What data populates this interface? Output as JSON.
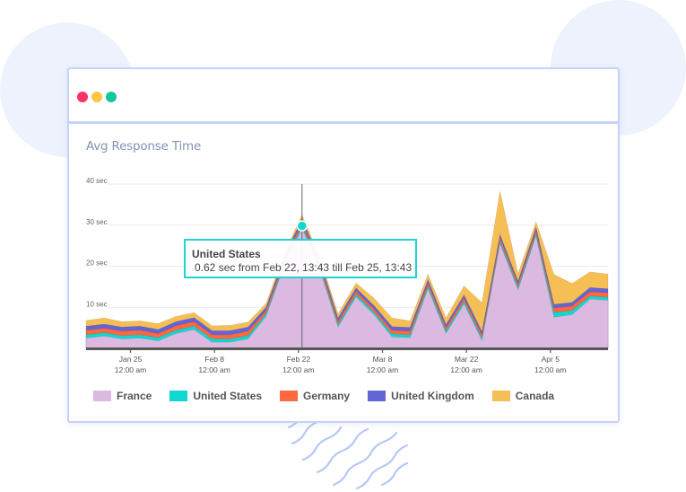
{
  "window": {
    "controls": [
      {
        "name": "close",
        "color": "#fb3263"
      },
      {
        "name": "minimize",
        "color": "#fcc644"
      },
      {
        "name": "maximize",
        "color": "#12c79a"
      }
    ]
  },
  "panel": {
    "title": "Avg Response Time"
  },
  "tooltip": {
    "series": "United States",
    "text": "0.62 sec from Feb 22, 13:43 till Feb 25, 13:43",
    "hover_index": 12
  },
  "chart_data": {
    "type": "area",
    "stacked": true,
    "title": "Avg Response Time",
    "xlabel": "",
    "ylabel": "",
    "ylim": [
      0,
      40
    ],
    "y_ticks": [
      {
        "value": 10,
        "label": "10 sec"
      },
      {
        "value": 20,
        "label": "20 sec"
      },
      {
        "value": 30,
        "label": "30 sec"
      },
      {
        "value": 40,
        "label": "40 sec"
      }
    ],
    "x_domain_days": [
      0,
      87
    ],
    "x_step_days": 3,
    "x_ticks": [
      {
        "day": 7.4,
        "line1": "Jan 25",
        "line2": "12:00 am"
      },
      {
        "day": 21.4,
        "line1": "Feb 8",
        "line2": "12:00 am"
      },
      {
        "day": 35.4,
        "line1": "Feb 22",
        "line2": "12:00 am"
      },
      {
        "day": 49.4,
        "line1": "Mar 8",
        "line2": "12:00 am"
      },
      {
        "day": 63.4,
        "line1": "Mar 22",
        "line2": "12:00 am"
      },
      {
        "day": 77.4,
        "line1": "Apr 5",
        "line2": "12:00 am"
      }
    ],
    "grid": true,
    "legend_position": "bottom-left",
    "series": [
      {
        "name": "France",
        "color": "#dbb9e1",
        "values": [
          2.5,
          3.0,
          2.3,
          2.5,
          1.8,
          3.6,
          4.6,
          1.5,
          1.5,
          2.3,
          7.8,
          20.0,
          29.2,
          19.0,
          5.2,
          12.5,
          8.2,
          2.8,
          2.6,
          14.5,
          3.6,
          10.8,
          1.9,
          25.5,
          14.2,
          27.3,
          7.6,
          8.2,
          12.0,
          11.7
        ]
      },
      {
        "name": "United States",
        "color": "#0fd8d3",
        "values": [
          0.8,
          0.8,
          0.8,
          0.8,
          0.8,
          0.8,
          0.8,
          0.8,
          0.8,
          0.8,
          0.6,
          0.6,
          0.62,
          0.6,
          0.6,
          0.6,
          0.6,
          0.7,
          0.7,
          0.6,
          0.6,
          0.6,
          0.6,
          0.6,
          0.6,
          0.6,
          1.1,
          1.0,
          0.7,
          0.7
        ]
      },
      {
        "name": "Germany",
        "color": "#fd6840",
        "values": [
          1.1,
          1.1,
          1.1,
          1.1,
          1.0,
          1.1,
          1.1,
          1.0,
          1.0,
          1.1,
          0.8,
          0.8,
          0.9,
          0.8,
          0.8,
          0.8,
          0.8,
          0.9,
          0.9,
          0.8,
          0.8,
          0.8,
          0.8,
          0.8,
          0.8,
          0.8,
          1.1,
          1.1,
          1.1,
          1.1
        ]
      },
      {
        "name": "United Kingdom",
        "color": "#6365d6",
        "values": [
          1.0,
          1.0,
          1.0,
          1.0,
          1.0,
          1.0,
          1.0,
          1.0,
          1.0,
          1.0,
          0.8,
          0.8,
          0.9,
          0.8,
          0.8,
          0.8,
          0.8,
          0.9,
          0.9,
          0.8,
          0.8,
          0.8,
          0.8,
          0.8,
          0.8,
          0.8,
          0.9,
          0.9,
          1.0,
          1.0
        ]
      },
      {
        "name": "Canada",
        "color": "#f6bf55",
        "values": [
          1.4,
          1.5,
          1.3,
          1.3,
          1.4,
          1.3,
          1.2,
          1.2,
          1.3,
          1.2,
          0.9,
          0.9,
          0.9,
          0.9,
          1.0,
          1.2,
          1.8,
          2.1,
          1.6,
          1.3,
          1.6,
          2.2,
          7.0,
          10.6,
          1.8,
          1.3,
          7.3,
          4.6,
          3.8,
          3.6
        ]
      }
    ]
  }
}
